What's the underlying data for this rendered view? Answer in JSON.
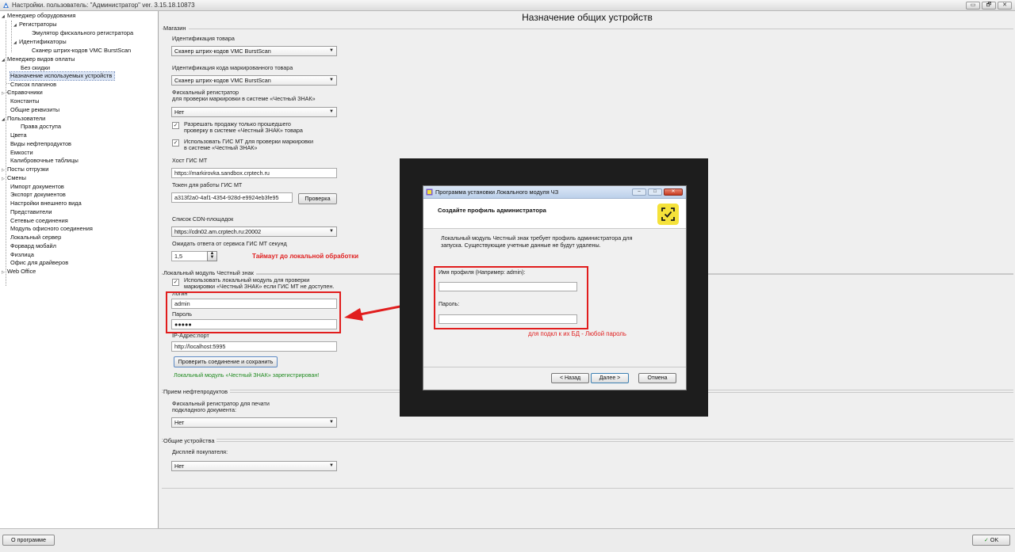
{
  "window": {
    "title": "Настройки. пользователь: \"Администратор\" ver. 3.15.18.10873",
    "controls": [
      "▭",
      "🗗",
      "✕"
    ]
  },
  "tree": [
    {
      "label": "Менеджер оборудования",
      "toggle": "◢"
    },
    {
      "label": "Регистраторы",
      "toggle": "◢"
    },
    {
      "label": "Эмулятор фискального регистратора",
      "toggle": ""
    },
    {
      "label": "Идентификаторы",
      "toggle": "◢"
    },
    {
      "label": "Сканер штрих-кодов VMC BurstScan",
      "toggle": ""
    },
    {
      "label": "Менеджер видов оплаты",
      "toggle": "◢"
    },
    {
      "label": "Без скидки",
      "toggle": ""
    },
    {
      "label": "Назначение используемых устройств",
      "toggle": ""
    },
    {
      "label": "Список плагинов",
      "toggle": ""
    },
    {
      "label": "Справочники",
      "toggle": "▷"
    },
    {
      "label": "Константы",
      "toggle": ""
    },
    {
      "label": "Общие реквизиты",
      "toggle": ""
    },
    {
      "label": "Пользователи",
      "toggle": "◢"
    },
    {
      "label": "Права доступа",
      "toggle": ""
    },
    {
      "label": "Цвета",
      "toggle": ""
    },
    {
      "label": "Виды нефтепродуктов",
      "toggle": ""
    },
    {
      "label": "Емкости",
      "toggle": ""
    },
    {
      "label": "Калибровочные таблицы",
      "toggle": ""
    },
    {
      "label": "Посты отгрузки",
      "toggle": "▷"
    },
    {
      "label": "Смены",
      "toggle": "▷"
    },
    {
      "label": "Импорт документов",
      "toggle": ""
    },
    {
      "label": "Экспорт документов",
      "toggle": ""
    },
    {
      "label": "Настройки внешнего вида",
      "toggle": ""
    },
    {
      "label": "Представители",
      "toggle": ""
    },
    {
      "label": "Сетевые соединения",
      "toggle": ""
    },
    {
      "label": "Модуль офисного соединения",
      "toggle": ""
    },
    {
      "label": "Локальный сервер",
      "toggle": ""
    },
    {
      "label": "Форвард мобайл",
      "toggle": ""
    },
    {
      "label": "Физлица",
      "toggle": ""
    },
    {
      "label": "Офис для драйверов",
      "toggle": ""
    },
    {
      "label": "Web Office",
      "toggle": "▷"
    }
  ],
  "page": {
    "title": "Назначение общих устройств",
    "shop": {
      "group_label": "Магазин",
      "product_id_label": "Идентификация товара",
      "product_id_value": "Сканер штрих-кодов VMC BurstScan",
      "marked_id_label": "Идентификация кода маркированного товара",
      "marked_id_value": "Сканер штрих-кодов VMC BurstScan",
      "fiscal_label_1": "Фискальный регистратор",
      "fiscal_label_2": "для проверки маркировки в системе «Честный ЗНАК»",
      "fiscal_value": "Нет",
      "allow_sale_1": "Разрешать продажу только прошедшего",
      "allow_sale_2": "проверку в системе «Честный ЗНАК» товара",
      "use_gis_1": "Использовать ГИС МТ для проверки маркировки",
      "use_gis_2": "в системе «Честный ЗНАК»",
      "gis_host_label": "Хост ГИС МТ",
      "gis_host_value": "https://markirovka.sandbox.crptech.ru",
      "gis_token_label": "Токен для работы ГИС МТ",
      "gis_token_value": "a313f2a0-4af1-4354-928d-e9924eb3fe95",
      "check_button": "Проверка",
      "cdn_label": "Список CDN-площадок",
      "cdn_value": "https://cdn02.am.crptech.ru:20002",
      "timeout_label": "Ожидать ответа от сервиса ГИС МТ секунд",
      "timeout_value": "1,5",
      "timeout_note": "Таймаут до локальной обработки"
    },
    "local_module": {
      "group_label": "Локальный модуль Честный знак",
      "use_local_1": "Использовать локальный модуль для проверки",
      "use_local_2": "маркировки «Честный ЗНАК» если ГИС МТ не доступен.",
      "login_label": "Логин",
      "login_value": "admin",
      "password_label": "Пароль",
      "password_value": "●●●●●",
      "ip_label": "IP-Адрес:порт",
      "ip_value": "http://localhost:5995",
      "check_save_button": "Проверить соединение и сохранить",
      "status": "Локальный модуль «Честный ЗНАК» зарегистрирован!"
    },
    "oil": {
      "group_label": "Прием нефтепродуктов",
      "fiscal_label_1": "Фискальный регистратор для печати",
      "fiscal_label_2": "подкладного документа:",
      "fiscal_value": "Нет"
    },
    "common": {
      "group_label": "Общие устройства",
      "display_label": "Дисплей покупателя:",
      "display_value": "Нет"
    }
  },
  "installer": {
    "title": "Программа установки Локального модуля ЧЗ",
    "header": "Создайте профиль администратора",
    "description_1": "Локальный модуль Честный знак требует профиль администратора для",
    "description_2": "запуска. Существующие учетные данные не будут удалены.",
    "profile_label": "Имя профиля (Например: admin):",
    "profile_value": "",
    "password_label": "Пароль:",
    "password_value": "",
    "back_button": "< Назад",
    "next_button": "Далее >",
    "cancel_button": "Отмена",
    "annotation": "для подкл к их БД - Любой пароль"
  },
  "footer": {
    "about_button": "О программе",
    "ok_button": "OK"
  },
  "colors": {
    "annotation_red": "#e11d1d",
    "status_green": "#1f8a1f",
    "logo_yellow": "#f5e23a"
  }
}
